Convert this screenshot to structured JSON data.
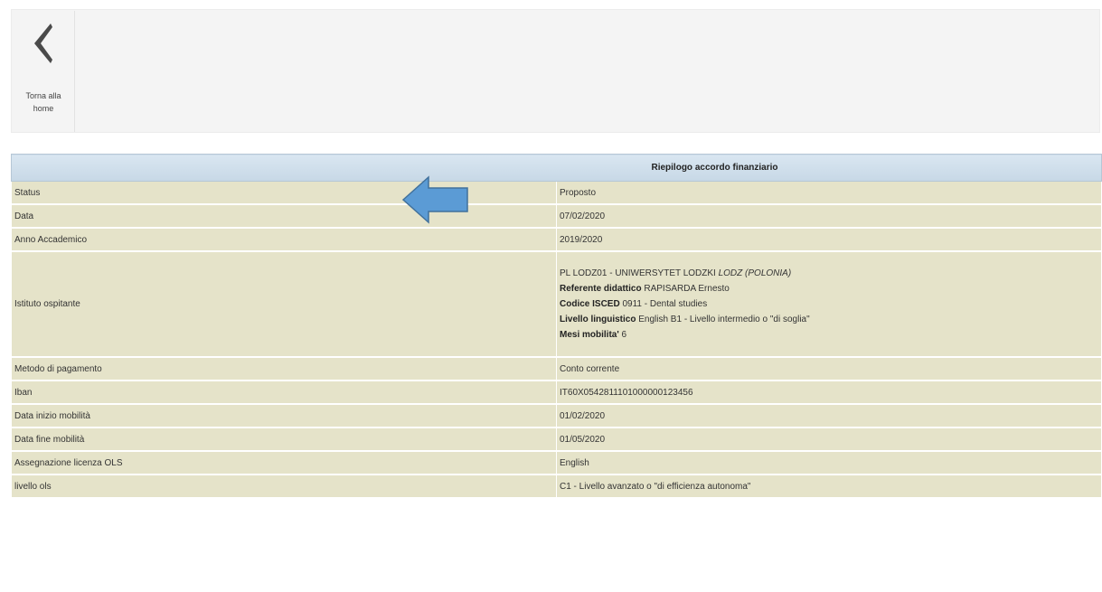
{
  "toolbar": {
    "back_label": "Torna alla\nhome",
    "back_icon": "chevron-left-icon"
  },
  "table": {
    "header": "Riepilogo accordo finanziario",
    "rows": [
      {
        "label": "Status",
        "value": "Proposto"
      },
      {
        "label": "Data",
        "value": "07/02/2020"
      },
      {
        "label": "Anno Accademico",
        "value": "2019/2020"
      },
      {
        "label": "Istituto ospitante",
        "value": ""
      },
      {
        "label": "Metodo di pagamento",
        "value": "Conto corrente"
      },
      {
        "label": "Iban",
        "value": "IT60X0542811101000000123456"
      },
      {
        "label": "Data inizio mobilità",
        "value": "01/02/2020"
      },
      {
        "label": "Data fine mobilità",
        "value": "01/05/2020"
      },
      {
        "label": "Assegnazione licenza OLS",
        "value": "English"
      },
      {
        "label": "livello ols",
        "value": "C1 - Livello avanzato o \"di efficienza autonoma\""
      }
    ],
    "institute": {
      "line1": "PL LODZ01 - UNIWERSYTET LODZKI",
      "line1_city": "LODZ (POLONIA)",
      "referente_label": "Referente didattico",
      "referente_value": "RAPISARDA Ernesto",
      "isced_label": "Codice ISCED",
      "isced_value": "0911 - Dental studies",
      "livello_label": "Livello linguistico",
      "livello_value": "English B1 - Livello intermedio o \"di soglia\"",
      "mesi_label": "Mesi mobilita'",
      "mesi_value": "6"
    }
  },
  "annotation": {
    "arrow_color": "#5b9bd5",
    "arrow_icon": "left-arrow-icon"
  }
}
